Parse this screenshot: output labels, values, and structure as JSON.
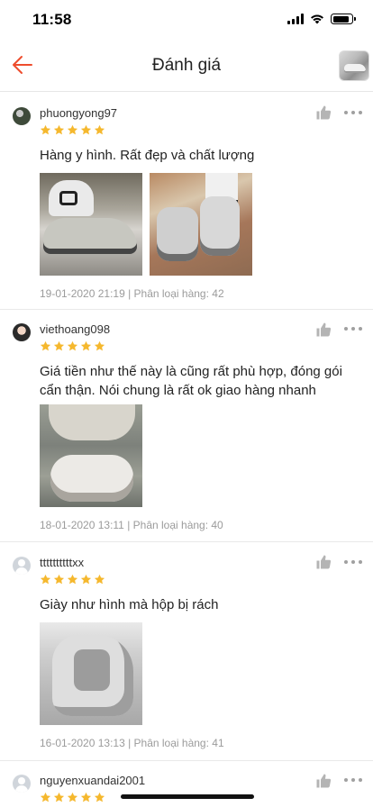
{
  "status_bar": {
    "time": "11:58"
  },
  "nav": {
    "title": "Đánh giá"
  },
  "colors": {
    "accent": "#ee4d2d",
    "star": "#f5b82e",
    "meta": "#9b9b9b"
  },
  "reviews": [
    {
      "username": "phuongyong97",
      "rating": 5,
      "text": "Hàng y hình. Rất đẹp và chất lượng",
      "meta": "19-01-2020 21:19 | Phân loại hàng: 42"
    },
    {
      "username": "viethoang098",
      "rating": 5,
      "text": "Giá tiền như thế này là cũng rất phù hợp, đóng gói cẩn thận. Nói chung là rất ok giao hàng nhanh",
      "meta": "18-01-2020 13:11 | Phân loại hàng: 40"
    },
    {
      "username": "ttttttttttxx",
      "rating": 5,
      "text": "Giày như hình mà hộp bị rách",
      "meta": "16-01-2020 13:13 | Phân loại hàng: 41"
    },
    {
      "username": "nguyenxuandai2001",
      "rating": 5
    }
  ]
}
